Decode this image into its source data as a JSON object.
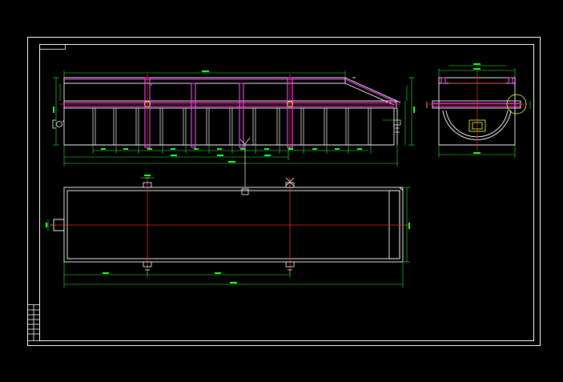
{
  "document": {
    "type": "CAD engineering drawing",
    "background": "#000000",
    "colors": {
      "frame": "#ffffff",
      "outline": "#ffffff",
      "structure": "#ff40ff",
      "centerline": "#ff2020",
      "dimension": "#22ff22",
      "detail": "#ffff40"
    }
  },
  "views": [
    {
      "id": "front-elevation"
    },
    {
      "id": "side-elevation"
    },
    {
      "id": "plan-view"
    }
  ],
  "title_block": {}
}
